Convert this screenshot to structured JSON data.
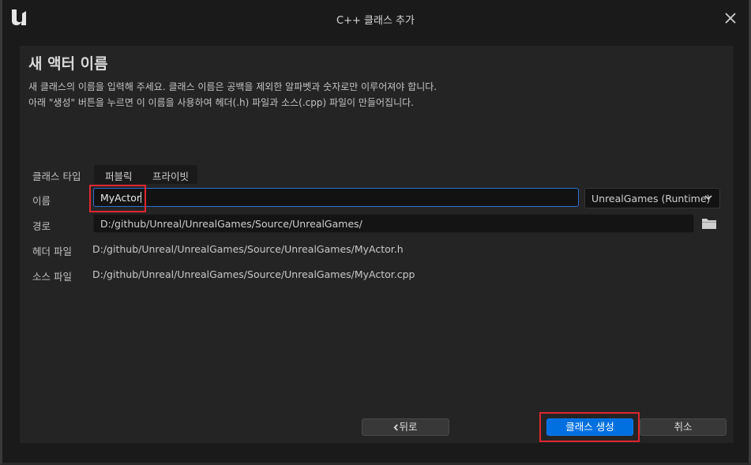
{
  "window": {
    "title": "C++ 클래스 추가"
  },
  "page": {
    "heading": "새 액터 이름",
    "description_line1": "새 클래스의 이름을 입력해 주세요. 클래스 이름은 공백을 제외한 알파벳과 숫자로만 이루어져야 합니다.",
    "description_line2": "아래 \"생성\" 버튼을 누르면 이 이름을 사용하여 헤더(.h) 파일과 소스(.cpp) 파일이 만들어집니다."
  },
  "form": {
    "class_type_label": "클래스 타입",
    "class_type_options": [
      "퍼블릭",
      "프라이빗"
    ],
    "name_label": "이름",
    "name_value": "MyActor",
    "module_value": "UnrealGames (Runtime)",
    "path_label": "경로",
    "path_value": "D:/github/Unreal/UnrealGames/Source/UnrealGames/",
    "header_label": "헤더 파일",
    "header_value": "D:/github/Unreal/UnrealGames/Source/UnrealGames/MyActor.h",
    "source_label": "소스 파일",
    "source_value": "D:/github/Unreal/UnrealGames/Source/UnrealGames/MyActor.cpp"
  },
  "buttons": {
    "back": "뒤로",
    "create": "클래스 생성",
    "cancel": "취소"
  },
  "icons": {
    "logo": "unreal-logo-icon",
    "close": "close-icon",
    "dropdown": "chevron-down-icon",
    "folder": "folder-icon",
    "back": "chevron-left-icon"
  },
  "colors": {
    "primary": "#0070e0",
    "highlight": "#e0262f",
    "input_focus": "#2f6fd6"
  }
}
